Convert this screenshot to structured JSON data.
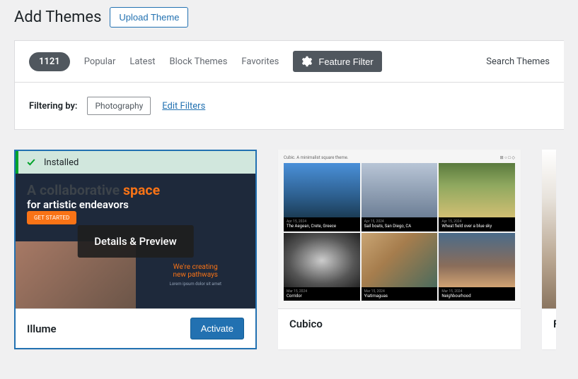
{
  "header": {
    "title": "Add Themes",
    "upload_label": "Upload Theme"
  },
  "filter_bar": {
    "count": "1121",
    "tabs": [
      "Popular",
      "Latest",
      "Block Themes",
      "Favorites"
    ],
    "feature_filter_label": "Feature Filter",
    "search_label": "Search Themes"
  },
  "sub_filter": {
    "filtering_by_label": "Filtering by:",
    "tags": [
      "Photography"
    ],
    "edit_filters_label": "Edit Filters"
  },
  "themes": [
    {
      "name": "Illume",
      "installed": true,
      "installed_label": "Installed",
      "details_label": "Details & Preview",
      "activate_label": "Activate",
      "preview": {
        "headline_a": "A collaborative",
        "headline_b": "space",
        "subhead": "for artistic endeavors",
        "right_a": "We're",
        "right_b": "creating",
        "right_c": "new pathways"
      }
    },
    {
      "name": "Cubico",
      "preview": {
        "tagline": "Cubic. A minimalist square theme.",
        "tiles": [
          {
            "date": "Apr 15, 2024",
            "title": "The Aegean, Crete, Greece"
          },
          {
            "date": "Apr 15, 2024",
            "title": "Sail boats, San Diego, CA"
          },
          {
            "date": "Apr 15, 2024",
            "title": "Wheat field over a blue sky"
          },
          {
            "date": "Mar 15, 2024",
            "title": "Corridor"
          },
          {
            "date": "Mar 15, 2024",
            "title": "Yiatimaguas"
          },
          {
            "date": "Mar 15, 2024",
            "title": "Neighbourhood"
          }
        ]
      }
    }
  ]
}
